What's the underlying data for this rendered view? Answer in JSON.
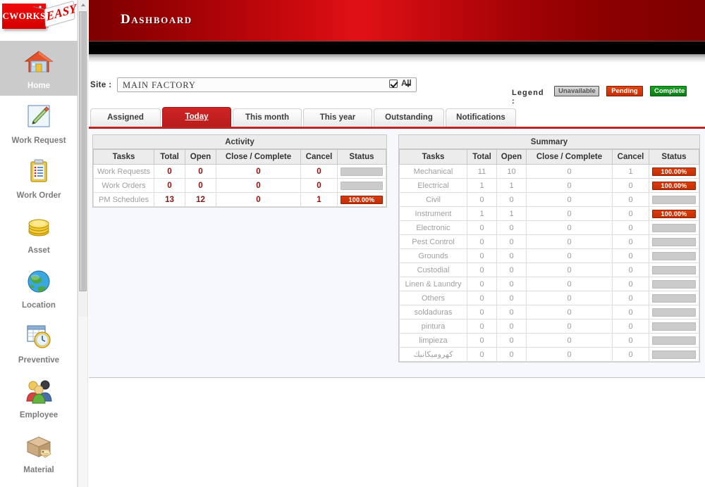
{
  "app": {
    "logo_text": "CWORKS",
    "logo_tm": "TM",
    "logo_badge": "EASY"
  },
  "sidebar": {
    "items": [
      {
        "label": "Home",
        "icon": "house-icon",
        "active": true
      },
      {
        "label": "Work Request",
        "icon": "pencil-icon",
        "active": false
      },
      {
        "label": "Work Order",
        "icon": "clipboard-icon",
        "active": false
      },
      {
        "label": "Asset",
        "icon": "coins-icon",
        "active": false
      },
      {
        "label": "Location",
        "icon": "globe-icon",
        "active": false
      },
      {
        "label": "Preventive",
        "icon": "calendar-clock-icon",
        "active": false
      },
      {
        "label": "Employee",
        "icon": "people-icon",
        "active": false
      },
      {
        "label": "Material",
        "icon": "box-tag-icon",
        "active": false
      }
    ]
  },
  "header": {
    "title": "Dashboard"
  },
  "site": {
    "label": "Site :",
    "value": "MAIN FACTORY",
    "all_label": "All",
    "all_checked": true
  },
  "legend": {
    "label": "Legend :",
    "unavailable": "Unavailable",
    "pending": "Pending",
    "complete": "Complete",
    "colors": {
      "unavailable": "#c9c9c9",
      "pending": "#d23a0a",
      "complete": "#12951e"
    }
  },
  "tabs": [
    {
      "label": "Assigned",
      "active": false
    },
    {
      "label": "Today",
      "active": true
    },
    {
      "label": "This month",
      "active": false
    },
    {
      "label": "This year",
      "active": false
    },
    {
      "label": "Outstanding",
      "active": false
    },
    {
      "label": "Notifications",
      "active": false
    }
  ],
  "activity": {
    "title": "Activity",
    "columns": [
      "Tasks",
      "Total",
      "Open",
      "Close / Complete",
      "Cancel",
      "Status"
    ],
    "rows": [
      {
        "task": "Work Requests",
        "total": "0",
        "open": "0",
        "close": "0",
        "cancel": "0",
        "pct": 0,
        "pct_label": ""
      },
      {
        "task": "Work Orders",
        "total": "0",
        "open": "0",
        "close": "0",
        "cancel": "0",
        "pct": 0,
        "pct_label": ""
      },
      {
        "task": "PM Schedules",
        "total": "13",
        "open": "12",
        "close": "0",
        "cancel": "1",
        "pct": 100,
        "pct_label": "100.00%"
      }
    ]
  },
  "summary": {
    "title": "Summary",
    "columns": [
      "Tasks",
      "Total",
      "Open",
      "Close / Complete",
      "Cancel",
      "Status"
    ],
    "rows": [
      {
        "task": "Mechanical",
        "total": "11",
        "open": "10",
        "close": "0",
        "cancel": "1",
        "pct": 100,
        "pct_label": "100.00%"
      },
      {
        "task": "Electrical",
        "total": "1",
        "open": "1",
        "close": "0",
        "cancel": "0",
        "pct": 100,
        "pct_label": "100.00%"
      },
      {
        "task": "Civil",
        "total": "0",
        "open": "0",
        "close": "0",
        "cancel": "0",
        "pct": 0,
        "pct_label": ""
      },
      {
        "task": "Instrument",
        "total": "1",
        "open": "1",
        "close": "0",
        "cancel": "0",
        "pct": 100,
        "pct_label": "100.00%"
      },
      {
        "task": "Electronic",
        "total": "0",
        "open": "0",
        "close": "0",
        "cancel": "0",
        "pct": 0,
        "pct_label": ""
      },
      {
        "task": "Pest Control",
        "total": "0",
        "open": "0",
        "close": "0",
        "cancel": "0",
        "pct": 0,
        "pct_label": ""
      },
      {
        "task": "Grounds",
        "total": "0",
        "open": "0",
        "close": "0",
        "cancel": "0",
        "pct": 0,
        "pct_label": ""
      },
      {
        "task": "Custodial",
        "total": "0",
        "open": "0",
        "close": "0",
        "cancel": "0",
        "pct": 0,
        "pct_label": ""
      },
      {
        "task": "Linen & Laundry",
        "total": "0",
        "open": "0",
        "close": "0",
        "cancel": "0",
        "pct": 0,
        "pct_label": ""
      },
      {
        "task": "Others",
        "total": "0",
        "open": "0",
        "close": "0",
        "cancel": "0",
        "pct": 0,
        "pct_label": ""
      },
      {
        "task": "soldaduras",
        "total": "0",
        "open": "0",
        "close": "0",
        "cancel": "0",
        "pct": 0,
        "pct_label": ""
      },
      {
        "task": "pintura",
        "total": "0",
        "open": "0",
        "close": "0",
        "cancel": "0",
        "pct": 0,
        "pct_label": ""
      },
      {
        "task": "limpieza",
        "total": "0",
        "open": "0",
        "close": "0",
        "cancel": "0",
        "pct": 0,
        "pct_label": ""
      },
      {
        "task": "كهروميكانيك",
        "total": "0",
        "open": "0",
        "close": "0",
        "cancel": "0",
        "pct": 0,
        "pct_label": "",
        "rtl": true
      }
    ]
  }
}
